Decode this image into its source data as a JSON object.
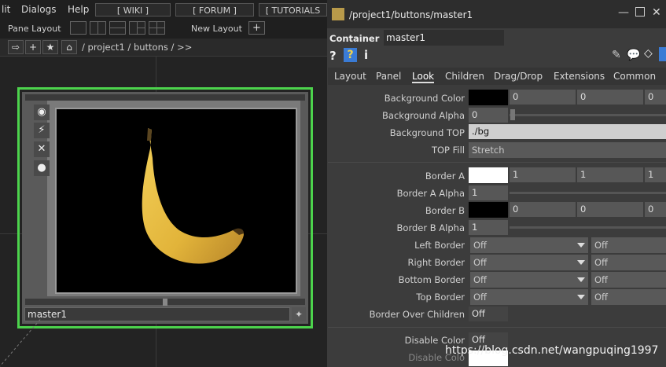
{
  "menubar": {
    "items": [
      "lit",
      "Dialogs",
      "Help"
    ],
    "boxes": [
      "[ WIKI ]",
      "[ FORUM ]",
      "[ TUTORIALS"
    ]
  },
  "toolbar": {
    "pane_layout": "Pane Layout",
    "new_layout": "New Layout",
    "plus": "+"
  },
  "pathbar": {
    "path": "/ project1 / buttons / >>"
  },
  "node": {
    "name": "master1"
  },
  "dialog": {
    "title": "/project1/buttons/master1",
    "type_label": "Container",
    "op_name": "master1",
    "tabs": [
      "Layout",
      "Panel",
      "Look",
      "Children",
      "Drag/Drop",
      "Extensions",
      "Common"
    ],
    "active_tab": "Look",
    "params": {
      "bg_color": {
        "label": "Background Color",
        "v1": "0",
        "v2": "0",
        "v3": "0",
        "color": "#000000"
      },
      "bg_alpha": {
        "label": "Background Alpha",
        "value": "0"
      },
      "bg_top": {
        "label": "Background TOP",
        "value": "./bg"
      },
      "top_fill": {
        "label": "TOP Fill",
        "value": "Stretch"
      },
      "border_a": {
        "label": "Border A",
        "v1": "1",
        "v2": "1",
        "v3": "1",
        "color": "#ffffff"
      },
      "border_a_alpha": {
        "label": "Border A Alpha",
        "value": "1"
      },
      "border_b": {
        "label": "Border B",
        "v1": "0",
        "v2": "0",
        "v3": "0",
        "color": "#000000"
      },
      "border_b_alpha": {
        "label": "Border B Alpha",
        "value": "1"
      },
      "left_border": {
        "label": "Left Border",
        "value": "Off",
        "value2": "Off"
      },
      "right_border": {
        "label": "Right Border",
        "value": "Off",
        "value2": "Off"
      },
      "bottom_border": {
        "label": "Bottom Border",
        "value": "Off",
        "value2": "Off"
      },
      "top_border": {
        "label": "Top Border",
        "value": "Off",
        "value2": "Off"
      },
      "border_over_children": {
        "label": "Border Over Children",
        "value": "Off"
      },
      "disable_color": {
        "label": "Disable Color",
        "value": "Off"
      },
      "disable_color2": {
        "label": "Disable Colo"
      }
    }
  },
  "watermark": "https://blog.csdn.net/wangpuqing1997",
  "colors": {
    "accent_green": "#4cd34c",
    "help_blue": "#3a7bd5"
  }
}
